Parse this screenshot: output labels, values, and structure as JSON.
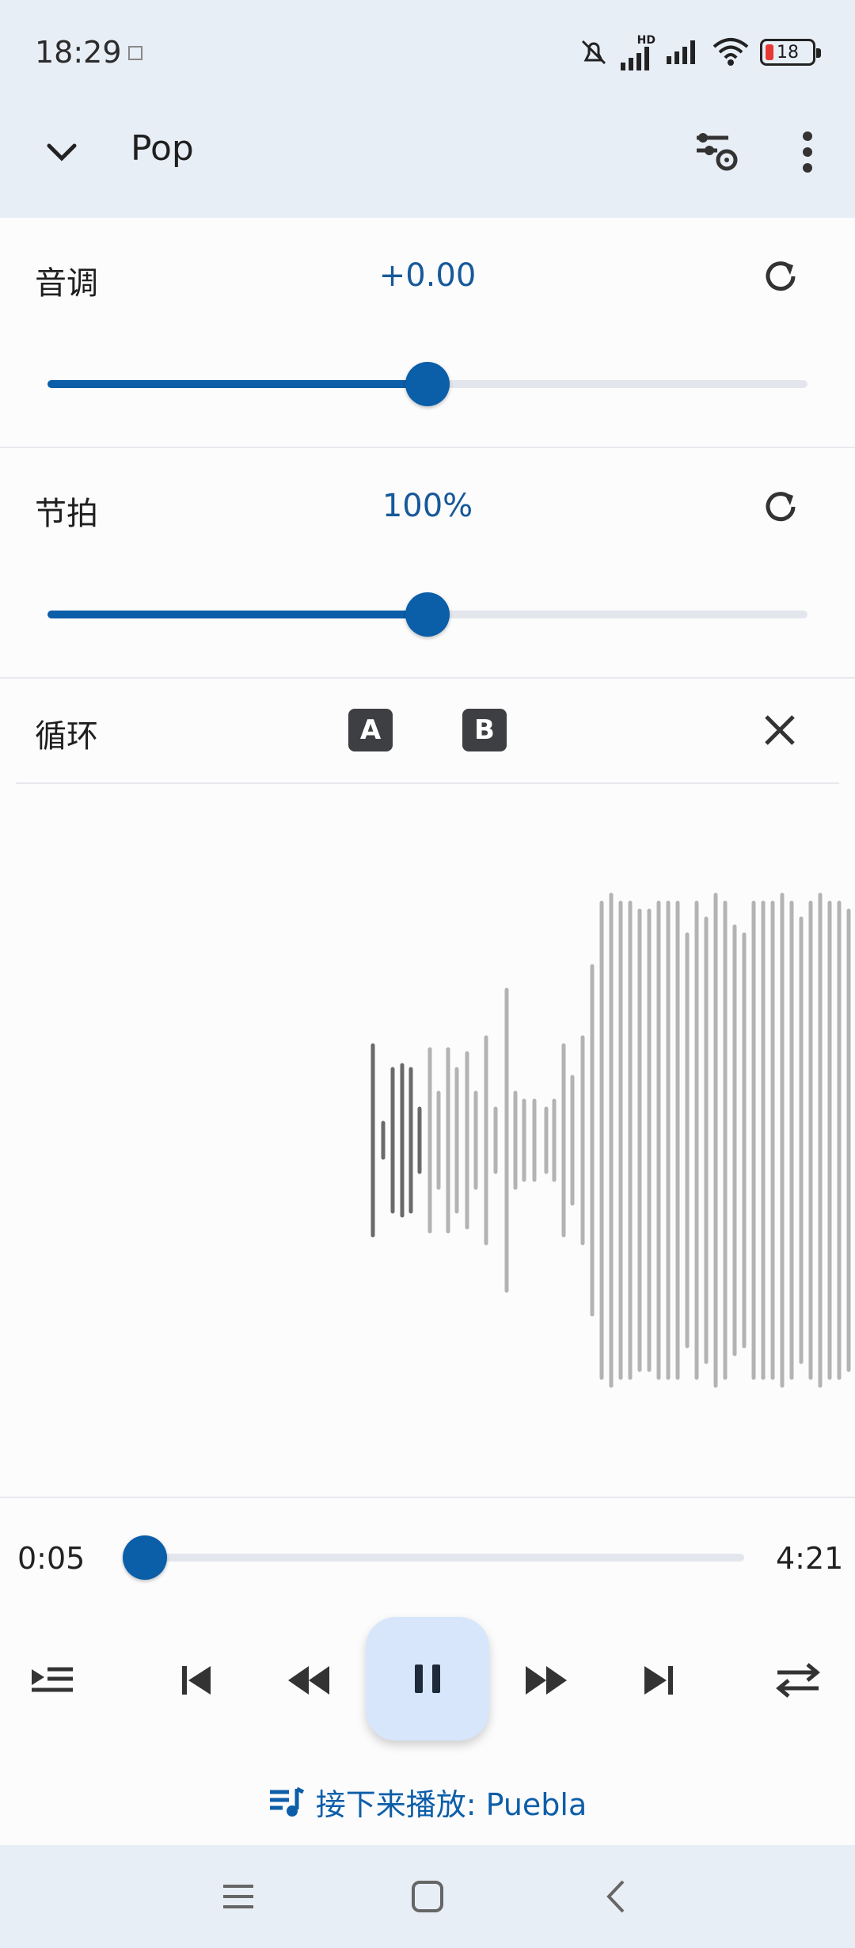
{
  "status_bar": {
    "time": "18:29",
    "battery": "18",
    "hd": "HD"
  },
  "header": {
    "title": "Pop"
  },
  "pitch": {
    "label": "音调",
    "value": "+0.00",
    "level": 0.5
  },
  "tempo": {
    "label": "节拍",
    "value": "100%",
    "level": 0.5
  },
  "loop": {
    "label": "循环",
    "a_label": "A",
    "b_label": "B"
  },
  "player": {
    "elapsed": "0:05",
    "duration": "4:21",
    "progress": 0.02
  },
  "next_up": {
    "text": "接下来播放: Puebla"
  },
  "colors": {
    "accent": "#0b5ea8",
    "header_bg": "#e8eef6",
    "waveform_played": "#6a6a6a",
    "waveform_unplayed": "#b3b3b3"
  },
  "icons": {
    "collapse": "chevron-down-icon",
    "settings": "tune-settings-icon",
    "more": "more-vert-icon",
    "reset": "reset-icon",
    "close": "close-icon",
    "queue": "queue-icon",
    "prev": "skip-previous-icon",
    "rewind": "rewind-icon",
    "pause": "pause-icon",
    "forward": "fast-forward-icon",
    "next": "skip-next-icon",
    "repeat": "repeat-icon",
    "playlist": "playlist-music-icon"
  }
}
